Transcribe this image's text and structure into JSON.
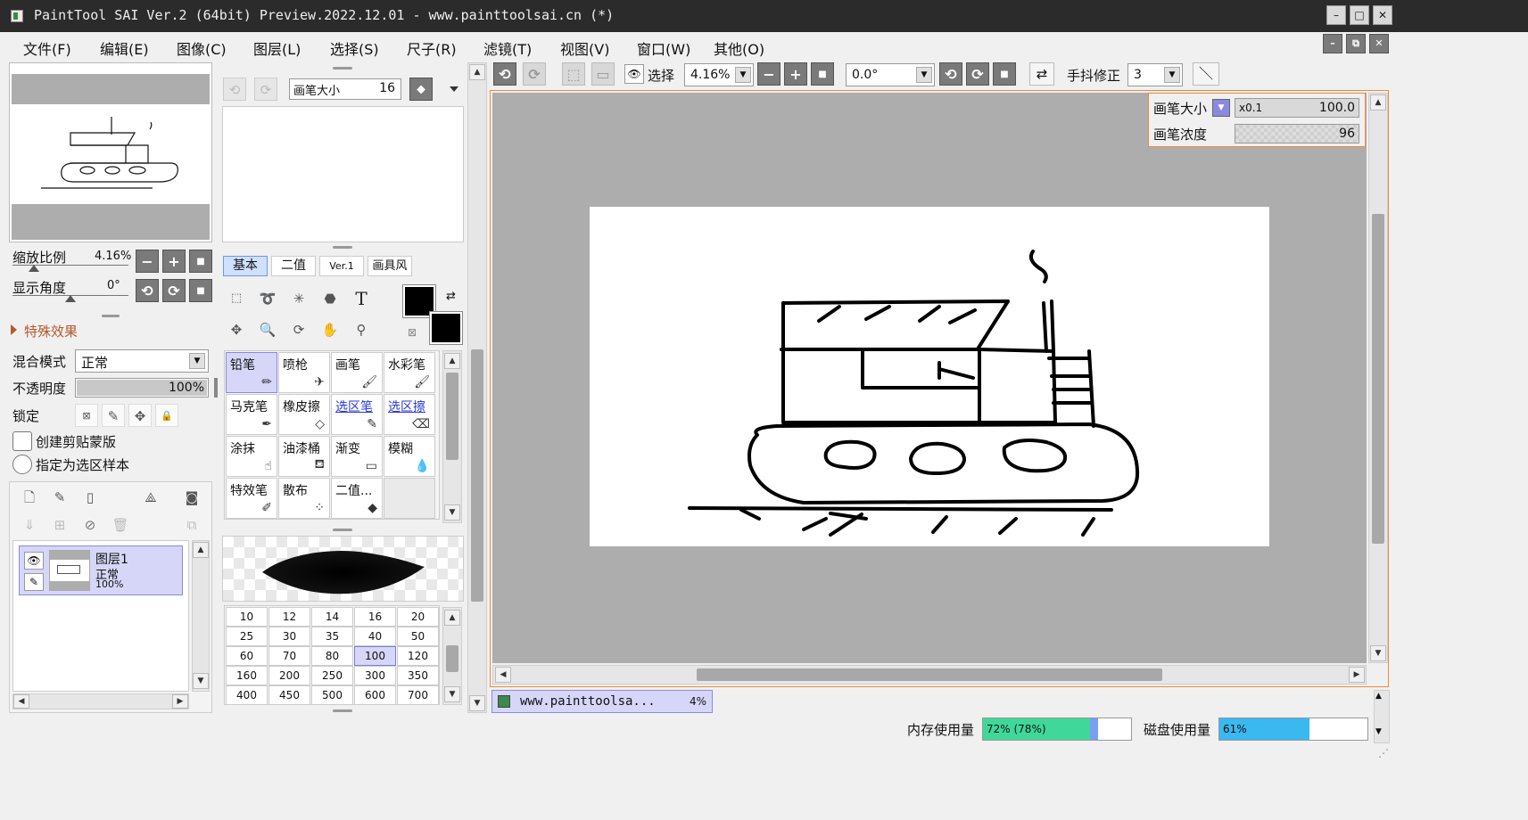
{
  "titlebar": {
    "title": "PaintTool SAI Ver.2 (64bit) Preview.2022.12.01 - www.painttoolsai.cn (*)",
    "min": "–",
    "max": "□",
    "close": "✕"
  },
  "menu": [
    "文件(F)",
    "编辑(E)",
    "图像(C)",
    "图层(L)",
    "选择(S)",
    "尺子(R)",
    "滤镜(T)",
    "视图(V)",
    "窗口(W)",
    "其他(O)"
  ],
  "navigator": {
    "zoom_label": "缩放比例",
    "zoom_value": "4.16%",
    "angle_label": "显示角度",
    "angle_value": "0°"
  },
  "layer_props": {
    "effects_label": "特殊效果",
    "blend_label": "混合模式",
    "blend_value": "正常",
    "opacity_label": "不透明度",
    "opacity_value": "100%",
    "opacity_fraction": 1.0,
    "lock_label": "锁定",
    "clip_label": "创建剪贴蒙版",
    "sample_label": "指定为选区样本"
  },
  "layers": [
    {
      "name": "图层1",
      "mode": "正常",
      "opacity": "100%"
    }
  ],
  "brush_panel": {
    "size_label": "画笔大小",
    "size_value": "16",
    "tabs": [
      "基本",
      "二值",
      "Ver.1",
      "画具风"
    ],
    "active_tab": 0,
    "tools": [
      {
        "name": "铅笔",
        "icon": "pencil-icon",
        "selected": true
      },
      {
        "name": "喷枪",
        "icon": "airbrush-icon"
      },
      {
        "name": "画笔",
        "icon": "brush-icon"
      },
      {
        "name": "水彩笔",
        "icon": "watercolor-icon"
      },
      {
        "name": "马克笔",
        "icon": "marker-icon"
      },
      {
        "name": "橡皮擦",
        "icon": "eraser-icon"
      },
      {
        "name": "选区笔",
        "icon": "selection-pen-icon",
        "link": true
      },
      {
        "name": "选区擦",
        "icon": "selection-eraser-icon",
        "link": true
      },
      {
        "name": "涂抹",
        "icon": "smudge-icon"
      },
      {
        "name": "油漆桶",
        "icon": "bucket-icon"
      },
      {
        "name": "渐变",
        "icon": "gradient-icon"
      },
      {
        "name": "模糊",
        "icon": "blur-icon"
      },
      {
        "name": "特效笔",
        "icon": "fx-pen-icon"
      },
      {
        "name": "散布",
        "icon": "scatter-icon"
      },
      {
        "name": "二值...",
        "icon": "binary-pen-icon"
      }
    ],
    "sizes": [
      "10",
      "12",
      "14",
      "16",
      "20",
      "25",
      "30",
      "35",
      "40",
      "50",
      "60",
      "70",
      "80",
      "100",
      "120",
      "160",
      "200",
      "250",
      "300",
      "350",
      "400",
      "450",
      "500",
      "600",
      "700"
    ],
    "selected_size": "100"
  },
  "canvas_toolbar": {
    "select_label": "选择",
    "zoom": "4.16%",
    "angle": "0.0°",
    "stabilizer_label": "手抖修正",
    "stabilizer_value": "3"
  },
  "brush_overlay": {
    "size_label": "画笔大小",
    "size_mult": "x0.1",
    "size_value": "100.0",
    "density_label": "画笔浓度",
    "density_value": "96"
  },
  "doc_tab": {
    "name": "www.painttoolsa...",
    "zoom": "4%"
  },
  "status": {
    "memory_label": "内存使用量",
    "memory_value": "72% (78%)",
    "memory_fraction": 0.72,
    "memory_peak_fraction": 0.78,
    "disk_label": "磁盘使用量",
    "disk_value": "61%",
    "disk_fraction": 0.61
  },
  "colors": {
    "accent_selected": "#d6d6f8",
    "memory_bar": "#3fd89a",
    "disk_bar": "#3ab8f0",
    "overlay_border": "#f08a3c"
  }
}
